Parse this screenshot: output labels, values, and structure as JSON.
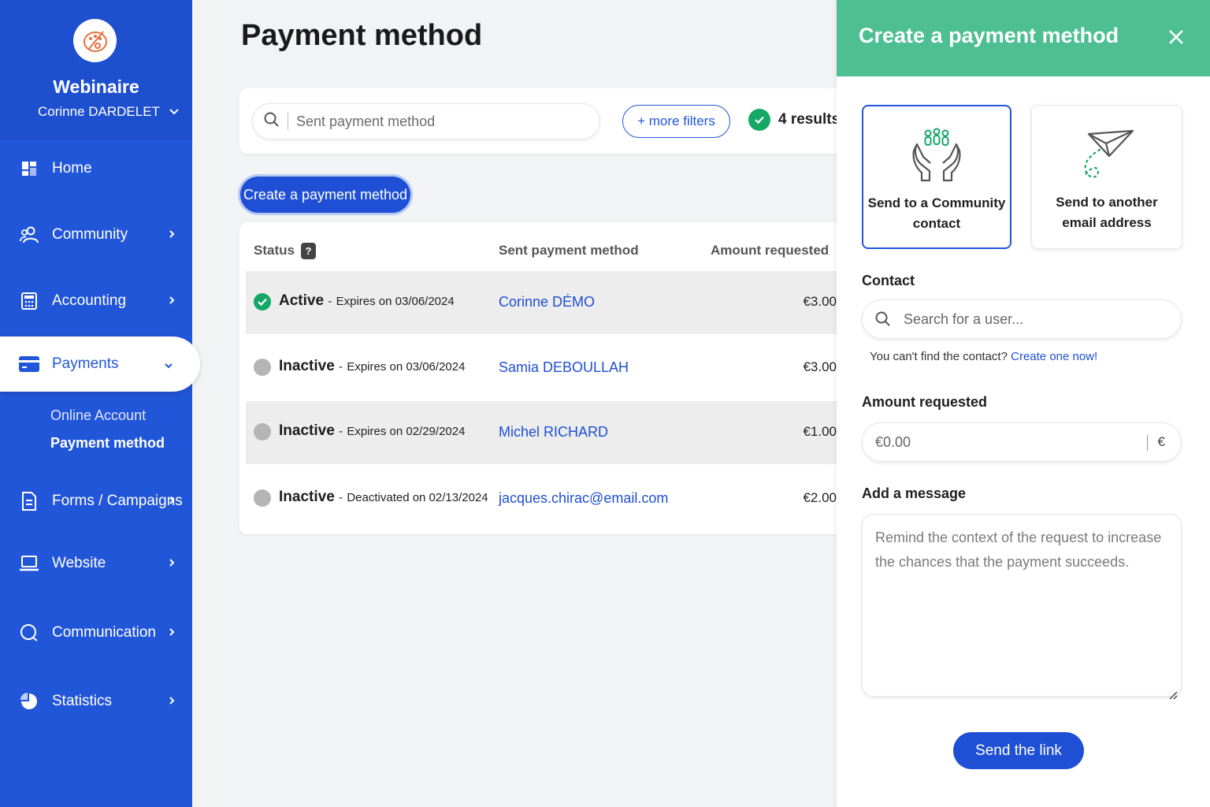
{
  "sidebar": {
    "org_name": "Webinaire",
    "user_name": "Corinne DARDELET",
    "items": [
      {
        "label": "Home",
        "icon": "dashboard-icon"
      },
      {
        "label": "Community",
        "icon": "users-icon"
      },
      {
        "label": "Accounting",
        "icon": "calculator-icon"
      },
      {
        "label": "Payments",
        "icon": "card-icon"
      },
      {
        "label": "Forms / Campaigns",
        "icon": "document-icon"
      },
      {
        "label": "Website",
        "icon": "laptop-icon"
      },
      {
        "label": "Communication",
        "icon": "chat-icon"
      },
      {
        "label": "Statistics",
        "icon": "pie-chart-icon"
      }
    ],
    "sub_items": [
      "Online Account",
      "Payment method"
    ]
  },
  "main": {
    "title": "Payment method",
    "search_placeholder": "Sent payment method",
    "more_filters": "+ more filters",
    "results": "4 results",
    "create_button": "Create a payment method",
    "columns": [
      "Status",
      "Sent payment method",
      "Amount requested"
    ],
    "help": "?",
    "rows": [
      {
        "status": "Active",
        "sep": "-",
        "date_text": "Expires on 03/06/2024",
        "who": "Corinne DÉMO",
        "amount": "€3.00"
      },
      {
        "status": "Inactive",
        "sep": "-",
        "date_text": "Expires on 03/06/2024",
        "who": "Samia DEBOULLAH",
        "amount": "€3.00"
      },
      {
        "status": "Inactive",
        "sep": "-",
        "date_text": "Expires on 02/29/2024",
        "who": "Michel RICHARD",
        "amount": "€1.00"
      },
      {
        "status": "Inactive",
        "sep": "-",
        "date_text": "Deactivated on 02/13/2024",
        "who": "jacques.chirac@email.com",
        "amount": "€2.00"
      }
    ]
  },
  "panel": {
    "title": "Create a payment method",
    "option_community_line1": "Send to a Community",
    "option_community_line2": "contact",
    "option_email_line1": "Send to another",
    "option_email_line2": "email address",
    "contact_label": "Contact",
    "contact_placeholder": "Search for a user...",
    "hint_text": "You can't find the contact?",
    "hint_link": "Create one now!",
    "amount_label": "Amount requested",
    "amount_placeholder": "€0.00",
    "currency": "€",
    "message_label": "Add a message",
    "message_placeholder": "Remind the context of the request to increase the chances that the payment succeeds.",
    "send_button": "Send the link"
  },
  "colors": {
    "brand_blue": "#2256d8",
    "panel_green": "#4dbf93",
    "active_green": "#14a765",
    "inactive_grey": "#b5b5b5"
  }
}
